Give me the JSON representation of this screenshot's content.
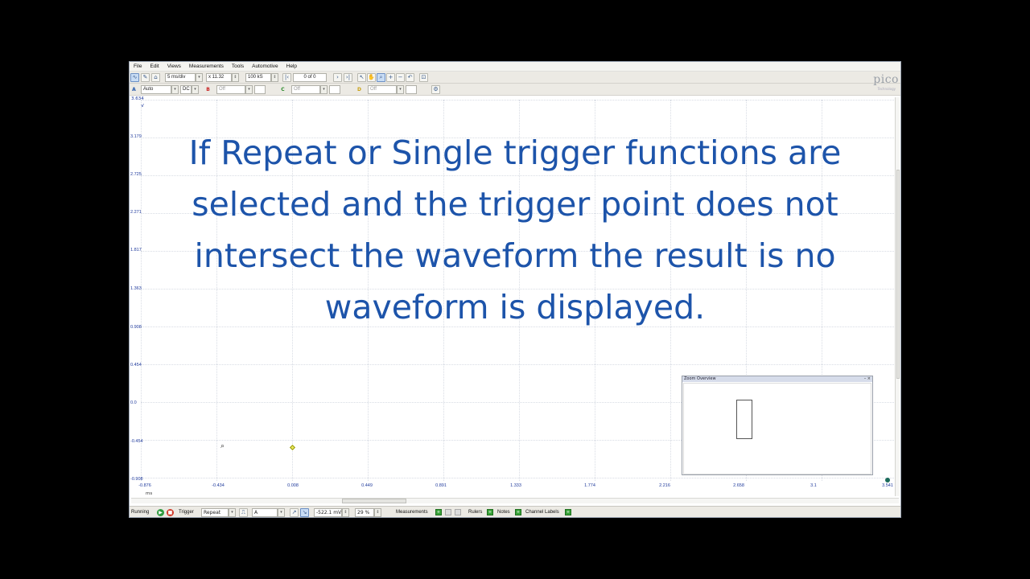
{
  "menu": [
    "File",
    "Edit",
    "Views",
    "Measurements",
    "Tools",
    "Automotive",
    "Help"
  ],
  "toolbar1": {
    "timebase": "5 ms/div",
    "zoom": "x 11.32",
    "samples": "100 kS",
    "buffer": "0 of 0"
  },
  "toolbar2": {
    "channel_a_range": "Auto",
    "channel_a_coupling": "DC",
    "channel_b_range": "Off",
    "channel_c_range": "Off",
    "channel_d_range": "Off"
  },
  "logo": "pico",
  "logo_sub": "Technology",
  "plot": {
    "y_unit": "V",
    "y_top": "3.634",
    "y_labels": [
      "3.179",
      "2.725",
      "2.271",
      "1.817",
      "1.363",
      "0.908",
      "0.454",
      "0.0",
      "-0.454",
      "-0.908"
    ],
    "x_unit": "ms",
    "x_labels": [
      "-0.876",
      "-0.434",
      "0.008",
      "0.449",
      "0.891",
      "1.333",
      "1.774",
      "2.216",
      "2.658",
      "3.1",
      "3.541"
    ]
  },
  "annotation": "If Repeat or Single trigger functions are selected and the trigger point does not intersect the waveform the result is no waveform is displayed.",
  "zoom_overview": {
    "title": "Zoom Overview"
  },
  "statusbar": {
    "running": "Running",
    "trigger_label": "Trigger",
    "trigger_mode": "Repeat",
    "trigger_source": "A",
    "threshold": "-522.1 mV",
    "pre_trigger": "29 %",
    "measurements": "Measurements",
    "rulers": "Rulers",
    "notes": "Notes",
    "channel_labels": "Channel Labels"
  },
  "colors": {
    "annotation": "#1d54aa",
    "axis_labels": "#1f3a9c",
    "trigger_marker": "#e8e85a"
  }
}
